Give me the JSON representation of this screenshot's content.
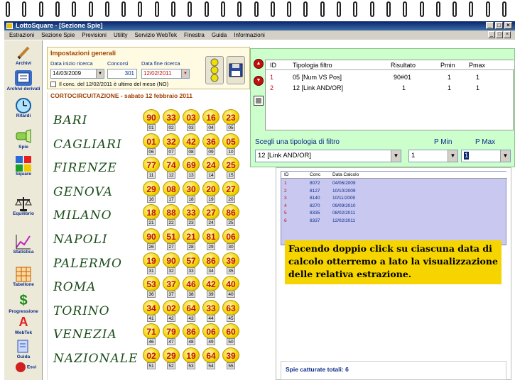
{
  "window": {
    "title": "LottoSquare - [Sezione Spie]",
    "buttons": [
      "_",
      "□",
      "×"
    ]
  },
  "menu": [
    "Estrazioni",
    "Sezione Spie",
    "Previsioni",
    "Utility",
    "Servizio WebTek",
    "Finestra",
    "Guida",
    "Informazioni"
  ],
  "toolbar": [
    {
      "label": "Archivi",
      "icon": "pencil-icon"
    },
    {
      "label": "Archivi derivati",
      "icon": "archive-icon"
    },
    {
      "label": "Ritardi",
      "icon": "clock-icon"
    },
    {
      "label": "Spie",
      "icon": "flashlight-icon"
    },
    {
      "label": "Square",
      "icon": "squares-icon"
    },
    {
      "label": "Equilibrio",
      "icon": "scale-icon"
    },
    {
      "label": "Statistica",
      "icon": "chart-icon"
    },
    {
      "label": "Tabellone",
      "icon": "table-icon"
    },
    {
      "label": "Progressione",
      "icon": "dollar-icon"
    },
    {
      "label": "WebTek",
      "icon": "webtek-icon"
    },
    {
      "label": "Guida",
      "icon": "guide-icon"
    },
    {
      "label": "Esci",
      "icon": "exit-icon"
    }
  ],
  "settings": {
    "heading": "Impostazioni generali",
    "start_label": "Data inizio ricerca",
    "start_value": "14/03/2009",
    "concorsi_label": "Concorsi",
    "concorsi_value": "301",
    "end_label": "Data fine ricerca",
    "end_value": "12/02/2011",
    "checkbox_label": "Il conc. del 12/02/2011 è ultimo del mese (NO)"
  },
  "corto": {
    "title": "CORTOCIRCUITAZIONE - sabato 12 febbraio 2011",
    "rows": [
      {
        "city": "BARI",
        "numbers": [
          "90",
          "33",
          "03",
          "16",
          "23"
        ],
        "positions": [
          "01",
          "02",
          "03",
          "04",
          "05"
        ]
      },
      {
        "city": "CAGLIARI",
        "numbers": [
          "01",
          "32",
          "42",
          "36",
          "05"
        ],
        "positions": [
          "06",
          "07",
          "08",
          "09",
          "10"
        ]
      },
      {
        "city": "FIRENZE",
        "numbers": [
          "77",
          "74",
          "69",
          "24",
          "25"
        ],
        "positions": [
          "11",
          "12",
          "13",
          "14",
          "15"
        ]
      },
      {
        "city": "GENOVA",
        "numbers": [
          "29",
          "08",
          "30",
          "20",
          "27"
        ],
        "positions": [
          "16",
          "17",
          "18",
          "19",
          "20"
        ]
      },
      {
        "city": "MILANO",
        "numbers": [
          "18",
          "88",
          "33",
          "27",
          "86"
        ],
        "positions": [
          "21",
          "22",
          "23",
          "24",
          "25"
        ]
      },
      {
        "city": "NAPOLI",
        "numbers": [
          "90",
          "51",
          "21",
          "81",
          "06"
        ],
        "positions": [
          "26",
          "27",
          "28",
          "29",
          "30"
        ]
      },
      {
        "city": "PALERMO",
        "numbers": [
          "19",
          "90",
          "57",
          "86",
          "39"
        ],
        "positions": [
          "31",
          "32",
          "33",
          "34",
          "35"
        ]
      },
      {
        "city": "ROMA",
        "numbers": [
          "53",
          "37",
          "46",
          "42",
          "40"
        ],
        "positions": [
          "36",
          "37",
          "38",
          "39",
          "40"
        ]
      },
      {
        "city": "TORINO",
        "numbers": [
          "34",
          "02",
          "64",
          "33",
          "63"
        ],
        "positions": [
          "41",
          "42",
          "43",
          "44",
          "45"
        ]
      },
      {
        "city": "VENEZIA",
        "numbers": [
          "71",
          "79",
          "86",
          "06",
          "60"
        ],
        "positions": [
          "46",
          "47",
          "48",
          "49",
          "50"
        ]
      },
      {
        "city": "NAZIONALE",
        "numbers": [
          "02",
          "29",
          "19",
          "64",
          "39"
        ],
        "positions": [
          "51",
          "52",
          "53",
          "54",
          "55"
        ]
      }
    ]
  },
  "filter": {
    "columns": [
      "ID",
      "Tipologia filtro",
      "Risultato",
      "Pmin",
      "Pmax"
    ],
    "rows": [
      {
        "id": "1",
        "tipo": "05 [Num VS Pos]",
        "risultato": "90#01",
        "pmin": "1",
        "pmax": "1"
      },
      {
        "id": "2",
        "tipo": "12 [Link AND/OR]",
        "risultato": "1",
        "pmin": "1",
        "pmax": "1"
      }
    ],
    "choose_label": "Scegli una tipologia di filtro",
    "pmin_label": "P Min",
    "pmax_label": "P Max",
    "type_value": "12 [Link AND/OR]",
    "pmin_value": "1",
    "pmax_value": "1"
  },
  "results": {
    "columns": [
      "ID",
      "Conc",
      "Data Calcolo"
    ],
    "rows": [
      {
        "id": "1",
        "conc": "8072",
        "date": "04/06/2009"
      },
      {
        "id": "2",
        "conc": "8127",
        "date": "10/10/2009"
      },
      {
        "id": "3",
        "conc": "8140",
        "date": "10/11/2009"
      },
      {
        "id": "4",
        "conc": "8270",
        "date": "09/09/2010"
      },
      {
        "id": "5",
        "conc": "8335",
        "date": "08/02/2011"
      },
      {
        "id": "6",
        "conc": "8337",
        "date": "12/02/2011"
      }
    ]
  },
  "callout": {
    "text": "Facendo doppio click su ciascuna data di calcolo otterremo a lato la visualizzazione delle relativa estrazione."
  },
  "footer": {
    "text": "Spie catturate totali: 6"
  }
}
